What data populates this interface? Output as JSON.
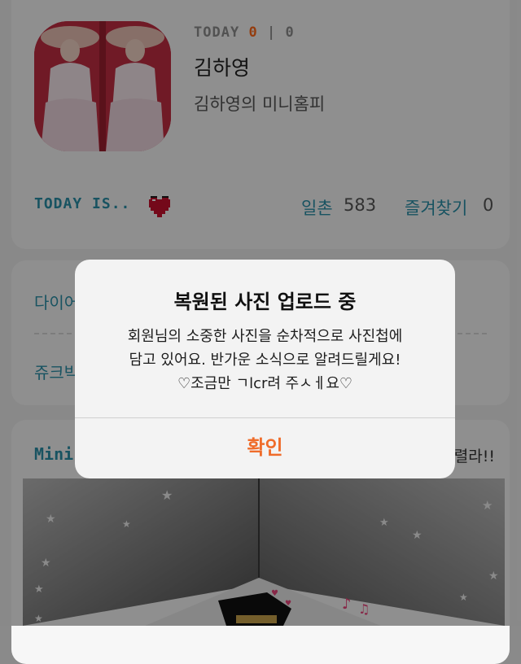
{
  "profile": {
    "today_label": "TODAY",
    "today_count": "0",
    "separator": "|",
    "total_count": "0",
    "name": "김하영",
    "homepage_title": "김하영의 미니홈피"
  },
  "stats": {
    "today_is": "TODAY IS..",
    "ilchon_label": "일촌",
    "ilchon_count": "583",
    "favorites_label": "즐겨찾기",
    "favorites_count": "0"
  },
  "menu": {
    "item1": "다이어",
    "item2": "쥬크박"
  },
  "miniroom": {
    "title": "Mini",
    "note": "렬라!!"
  },
  "dialog": {
    "title": "복원된 사진 업로드 중",
    "line1": "회원님의 소중한 사진을 순차적으로 사진첩에",
    "line2": "담고 있어요. 반가운 소식으로 알려드릴게요!",
    "line3": "♡조금만 ㄱlcr려 주ㅅㅔ요♡",
    "confirm_label": "확인"
  },
  "colors": {
    "accent_teal": "#2a8fa8",
    "accent_orange": "#ff6a1a",
    "confirm_orange": "#ef6c2a"
  },
  "icons": {
    "mood": "pixel-heart-icon"
  }
}
